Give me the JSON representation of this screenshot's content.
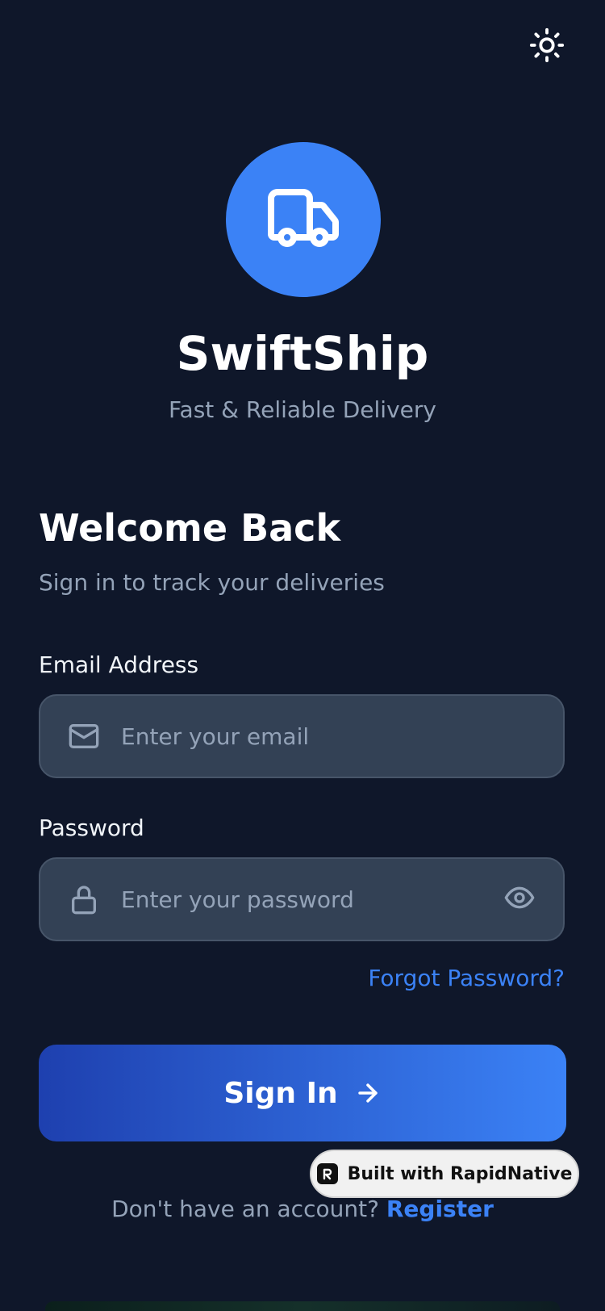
{
  "app": {
    "name": "SwiftShip",
    "tagline": "Fast & Reliable Delivery",
    "logo_icon": "truck-icon",
    "logo_color": "#3b82f6"
  },
  "header": {
    "theme_toggle_icon": "sun-icon"
  },
  "welcome": {
    "title": "Welcome Back",
    "subtitle": "Sign in to track your deliveries"
  },
  "form": {
    "email": {
      "label": "Email Address",
      "placeholder": "Enter your email",
      "value": "",
      "icon": "mail-icon"
    },
    "password": {
      "label": "Password",
      "placeholder": "Enter your password",
      "value": "",
      "icon": "lock-icon",
      "toggle_icon": "eye-icon"
    },
    "forgot_password_label": "Forgot Password?",
    "sign_in_label": "Sign In",
    "sign_in_icon": "arrow-right-icon"
  },
  "footer": {
    "register_prompt": "Don't have an account?",
    "register_label": "Register"
  },
  "badge": {
    "label": "Built with RapidNative",
    "icon": "rapidnative-logo-icon"
  },
  "colors": {
    "background": "#0f172a",
    "accent": "#3b82f6",
    "gradient_start": "#1e40af",
    "gradient_end": "#3b82f6",
    "input_background": "#334155",
    "muted_text": "#94a3b8"
  }
}
